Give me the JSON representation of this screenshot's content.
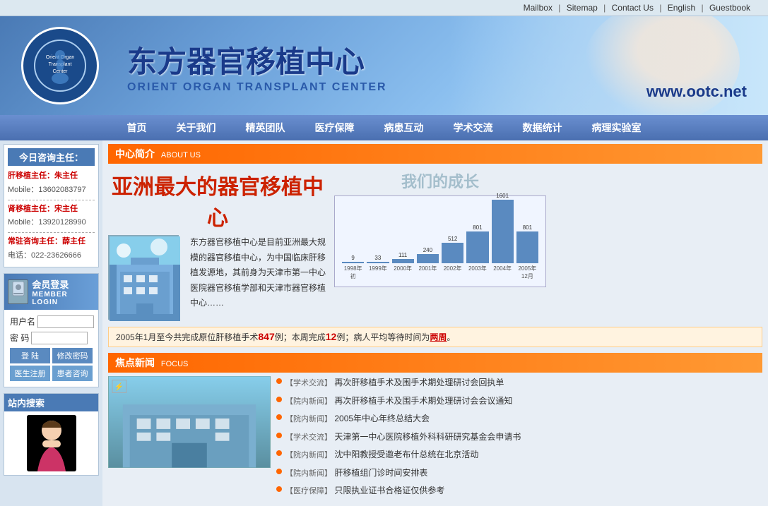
{
  "topbar": {
    "links": [
      {
        "label": "Mailbox",
        "id": "mailbox"
      },
      {
        "label": "Sitemap",
        "id": "sitemap"
      },
      {
        "label": "Contact Us",
        "id": "contact"
      },
      {
        "label": "English",
        "id": "english"
      },
      {
        "label": "Guestbook",
        "id": "guestbook"
      }
    ]
  },
  "header": {
    "title_zh": "东方器官移植中心",
    "title_en": "ORIENT ORGAN TRANSPLANT CENTER",
    "url": "www.ootc.net"
  },
  "nav": {
    "items": [
      "首页",
      "关于我们",
      "精英团队",
      "医疗保障",
      "病患互动",
      "学术交流",
      "数据统计",
      "病理实验室"
    ]
  },
  "sidebar": {
    "consultant_title": "今日咨询主任：",
    "liver_title": "肝移植主任：朱主任",
    "liver_phone": "Mobile：13602083797",
    "kidney_title": "肾移植主任：宋主任",
    "kidney_phone": "Mobile：13920128990",
    "regular_title": "常驻咨询主任：薛主任",
    "regular_phone": "电话：022-23626666",
    "login_title": "会员登录",
    "login_en": "MEMBER LOGIN",
    "username_label": "用户名",
    "password_label": "密  码",
    "login_button": "登  陆",
    "modify_button": "修改密码",
    "doctor_reg": "医生注册",
    "patient_consult": "患者咨询",
    "search_title": "站内搜索"
  },
  "about": {
    "section_title": "中心简介",
    "section_en": "ABOUT US",
    "big_title": "亚洲最大的器官移植中心",
    "intro_text": "东方器官移植中心是目前亚洲最大规模的器官移植中心，为中国临床肝移植发源地，其前身为天津市第一中心医院器官移植学部和天津市器官移植中心……"
  },
  "chart": {
    "title": "我们的成长",
    "bars": [
      {
        "value": 9,
        "year": "1998年初"
      },
      {
        "value": 33,
        "year": "1999年"
      },
      {
        "value": 111,
        "year": "2000年"
      },
      {
        "value": 240,
        "year": "2001年"
      },
      {
        "value": 512,
        "year": "2002年"
      },
      {
        "value": 801,
        "year": "2003年"
      },
      {
        "value": 1601,
        "year": "2004年"
      },
      {
        "value": 801,
        "year": "2005年12月"
      }
    ]
  },
  "stats": {
    "text": "2005年1月至今共完成原位肝移植手术",
    "count": "847",
    "text2": "例；本周完成",
    "week": "12",
    "text3": "例；病人平均等待时间为",
    "wait": "两周",
    "period": "。"
  },
  "news": {
    "section_title": "焦点新闻",
    "section_en": "FOCUS",
    "items": [
      {
        "tag": "【学术交流】",
        "text": "再次肝移植手术及围手术期处理研讨会回执单"
      },
      {
        "tag": "【院内新闻】",
        "text": "再次肝移植手术及围手术期处理研讨会会议通知"
      },
      {
        "tag": "【院内新闻】",
        "text": "2005年中心年终总结大会"
      },
      {
        "tag": "【学术交流】",
        "text": "天津第一中心医院移植外科科研研究基金会申请书"
      },
      {
        "tag": "【院内新闻】",
        "text": "沈中阳教授受邀老布什总统在北京活动"
      },
      {
        "tag": "【院内新闻】",
        "text": "肝移植组门诊时间安排表"
      },
      {
        "tag": "【医疗保障】",
        "text": "只限执业证书合格证仅供参考"
      }
    ]
  }
}
